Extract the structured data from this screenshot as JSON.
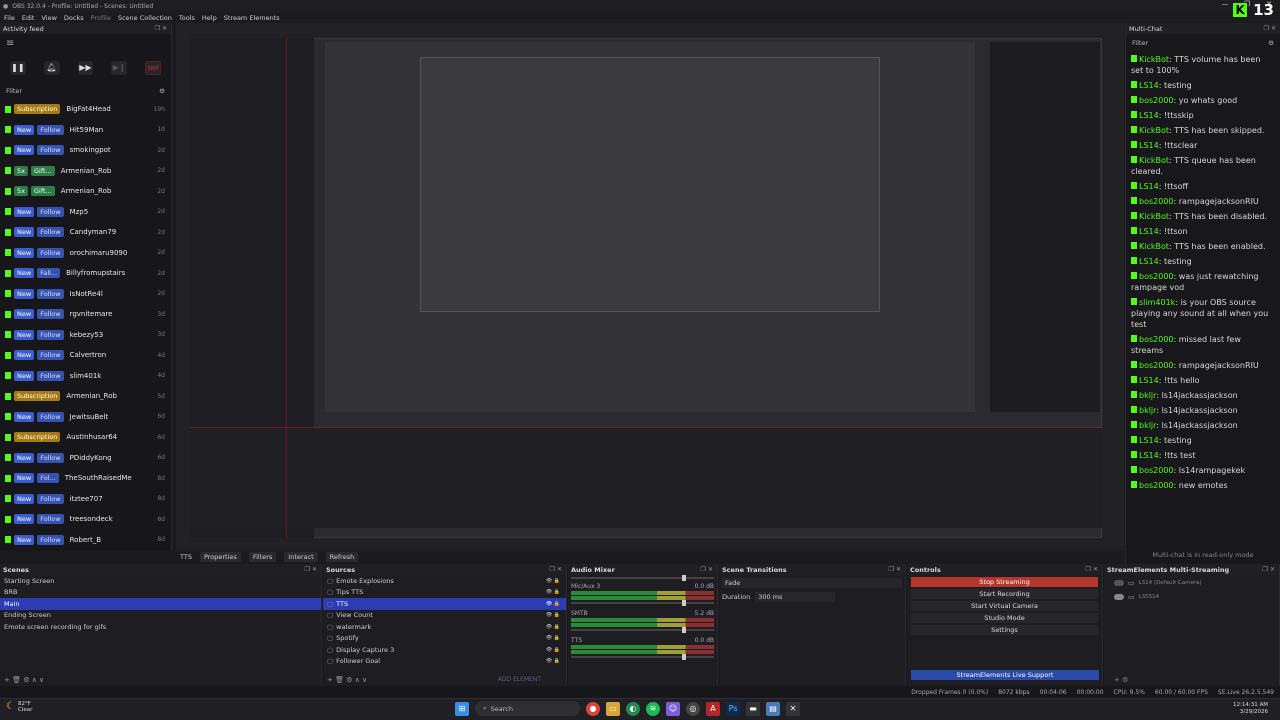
{
  "window": {
    "title": "OBS 32.0.4 - Profile: Untitled - Scenes: Untitled",
    "min": "—",
    "max": "❐",
    "close": "✕"
  },
  "menu": [
    "File",
    "Edit",
    "View",
    "Docks",
    "Profile",
    "Scene Collection",
    "Tools",
    "Help",
    "Stream Elements"
  ],
  "kick_viewers": "13",
  "activity_feed": {
    "title": "Activity feed",
    "filter_label": "Filter",
    "skip_label": "SKIP",
    "items": [
      {
        "badge1": "Subscription",
        "badge2": "",
        "name": "BigFat4Head",
        "time": "19h",
        "type": "sub"
      },
      {
        "badge1": "New",
        "badge2": "Follow",
        "name": "Hit59Man",
        "time": "1d",
        "type": "follow"
      },
      {
        "badge1": "New",
        "badge2": "Follow",
        "name": "smokingpot",
        "time": "2d",
        "type": "follow"
      },
      {
        "badge1": "5x",
        "badge2": "Gift...",
        "name": "Armenian_Rob",
        "time": "2d",
        "type": "gift"
      },
      {
        "badge1": "5x",
        "badge2": "Gift...",
        "name": "Armenian_Rob",
        "time": "2d",
        "type": "gift"
      },
      {
        "badge1": "New",
        "badge2": "Follow",
        "name": "Mzp5",
        "time": "2d",
        "type": "follow"
      },
      {
        "badge1": "New",
        "badge2": "Follow",
        "name": "Candyman79",
        "time": "2d",
        "type": "follow"
      },
      {
        "badge1": "New",
        "badge2": "Follow",
        "name": "orochimaru9090",
        "time": "2d",
        "type": "follow"
      },
      {
        "badge1": "New",
        "badge2": "Fall...",
        "name": "Billyfromupstairs",
        "time": "2d",
        "type": "follow"
      },
      {
        "badge1": "New",
        "badge2": "Follow",
        "name": "IsNotRe4l",
        "time": "2d",
        "type": "follow"
      },
      {
        "badge1": "New",
        "badge2": "Follow",
        "name": "rgvnitemare",
        "time": "3d",
        "type": "follow"
      },
      {
        "badge1": "New",
        "badge2": "Follow",
        "name": "kebezy53",
        "time": "3d",
        "type": "follow"
      },
      {
        "badge1": "New",
        "badge2": "Follow",
        "name": "Calvertron",
        "time": "4d",
        "type": "follow"
      },
      {
        "badge1": "New",
        "badge2": "Follow",
        "name": "slim401k",
        "time": "4d",
        "type": "follow"
      },
      {
        "badge1": "Subscription",
        "badge2": "",
        "name": "Armenian_Rob",
        "time": "5d",
        "type": "sub"
      },
      {
        "badge1": "New",
        "badge2": "Follow",
        "name": "JewitsuBelt",
        "time": "6d",
        "type": "follow"
      },
      {
        "badge1": "Subscription",
        "badge2": "",
        "name": "AustInhusar64",
        "time": "6d",
        "type": "sub"
      },
      {
        "badge1": "New",
        "badge2": "Follow",
        "name": "PDiddyKong",
        "time": "6d",
        "type": "follow"
      },
      {
        "badge1": "New",
        "badge2": "Fol...",
        "name": "TheSouthRaisedMe",
        "time": "8d",
        "type": "follow"
      },
      {
        "badge1": "New",
        "badge2": "Follow",
        "name": "itztee707",
        "time": "8d",
        "type": "follow"
      },
      {
        "badge1": "New",
        "badge2": "Follow",
        "name": "treesondeck",
        "time": "8d",
        "type": "follow"
      },
      {
        "badge1": "New",
        "badge2": "Follow",
        "name": "Robert_B",
        "time": "8d",
        "type": "follow"
      }
    ]
  },
  "multichat": {
    "title": "Multi-Chat",
    "filter_label": "Filter",
    "footer": "Multi-chat is in read-only mode",
    "messages": [
      {
        "user": "KickBot",
        "text": "TTS volume has been set to 100%"
      },
      {
        "user": "LS14",
        "text": "testing"
      },
      {
        "user": "bos2000",
        "text": "yo whats good"
      },
      {
        "user": "LS14",
        "text": "!ttsskip"
      },
      {
        "user": "KickBot",
        "text": "TTS has been skipped."
      },
      {
        "user": "LS14",
        "text": "!ttsclear"
      },
      {
        "user": "KickBot",
        "text": "TTS queue has been cleared."
      },
      {
        "user": "LS14",
        "text": "!ttsoff"
      },
      {
        "user": "bos2000",
        "text": "rampagejacksonRIU"
      },
      {
        "user": "KickBot",
        "text": "TTS has been disabled."
      },
      {
        "user": "LS14",
        "text": "!ttson"
      },
      {
        "user": "KickBot",
        "text": "TTS has been enabled."
      },
      {
        "user": "LS14",
        "text": "testing"
      },
      {
        "user": "bos2000",
        "text": "was just rewatching rampage vod"
      },
      {
        "user": "slim401k",
        "text": "is your OBS source playing any sound at all when you test"
      },
      {
        "user": "bos2000",
        "text": "missed last few streams"
      },
      {
        "user": "bos2000",
        "text": "rampagejacksonRIU"
      },
      {
        "user": "LS14",
        "text": "!tts hello"
      },
      {
        "user": "bkljr",
        "text": "ls14jackassjackson"
      },
      {
        "user": "bkljr",
        "text": "ls14jackassjackson"
      },
      {
        "user": "bkljr",
        "text": "ls14jackassjackson"
      },
      {
        "user": "LS14",
        "text": "testing"
      },
      {
        "user": "LS14",
        "text": "!tts test"
      },
      {
        "user": "bos2000",
        "text": "ls14rampagekek"
      },
      {
        "user": "bos2000",
        "text": "new emotes"
      }
    ]
  },
  "preview_toolbar": {
    "source": "TTS",
    "properties": "Properties",
    "filters": "Filters",
    "interact": "Interact",
    "refresh": "Refresh"
  },
  "scenes": {
    "title": "Scenes",
    "items": [
      "Starting Screen",
      "BRB",
      "Main",
      "Ending Screen",
      "Emote screen recording for gifs"
    ],
    "selected": 2
  },
  "sources": {
    "title": "Sources",
    "items": [
      "Emote Explosions",
      "Tips TTS",
      "TTS",
      "View Count",
      "watermark",
      "Spotify",
      "Display Capture 3",
      "Follower Goal"
    ],
    "selected": 2,
    "add_element": "ADD ELEMENT"
  },
  "mixer": {
    "title": "Audio Mixer",
    "channels": [
      {
        "name": "Mic/Aux 3",
        "db": "0.0 dB"
      },
      {
        "name": "SMTB",
        "db": "5.2 dB"
      },
      {
        "name": "TTS",
        "db": "0.0 dB"
      }
    ]
  },
  "transitions": {
    "title": "Scene Transitions",
    "type": "Fade",
    "duration_label": "Duration",
    "duration_value": "300 ms"
  },
  "controls": {
    "title": "Controls",
    "buttons": [
      "Stop Streaming",
      "Start Recording",
      "Start Virtual Camera",
      "Studio Mode",
      "Settings"
    ],
    "live_support": "StreamElements Live Support"
  },
  "se_multistream": {
    "title": "StreamElements Multi-Streaming",
    "row1": "LS14 (Default Camera)",
    "row2": "LS5514"
  },
  "status": {
    "dropped": "Dropped Frames 0 (0.0%)",
    "kbps": "8072 kbps",
    "time1": "00:04:06",
    "time2": "00:00:00",
    "cpu": "CPU: 9.5%",
    "fps": "60.00 / 60.00 FPS",
    "se": "SE.Live 26.2.5.549"
  },
  "taskbar": {
    "temp": "82°F",
    "cond": "Clear",
    "search": "Search",
    "time": "12:14:31 AM",
    "date": "3/29/2026"
  }
}
